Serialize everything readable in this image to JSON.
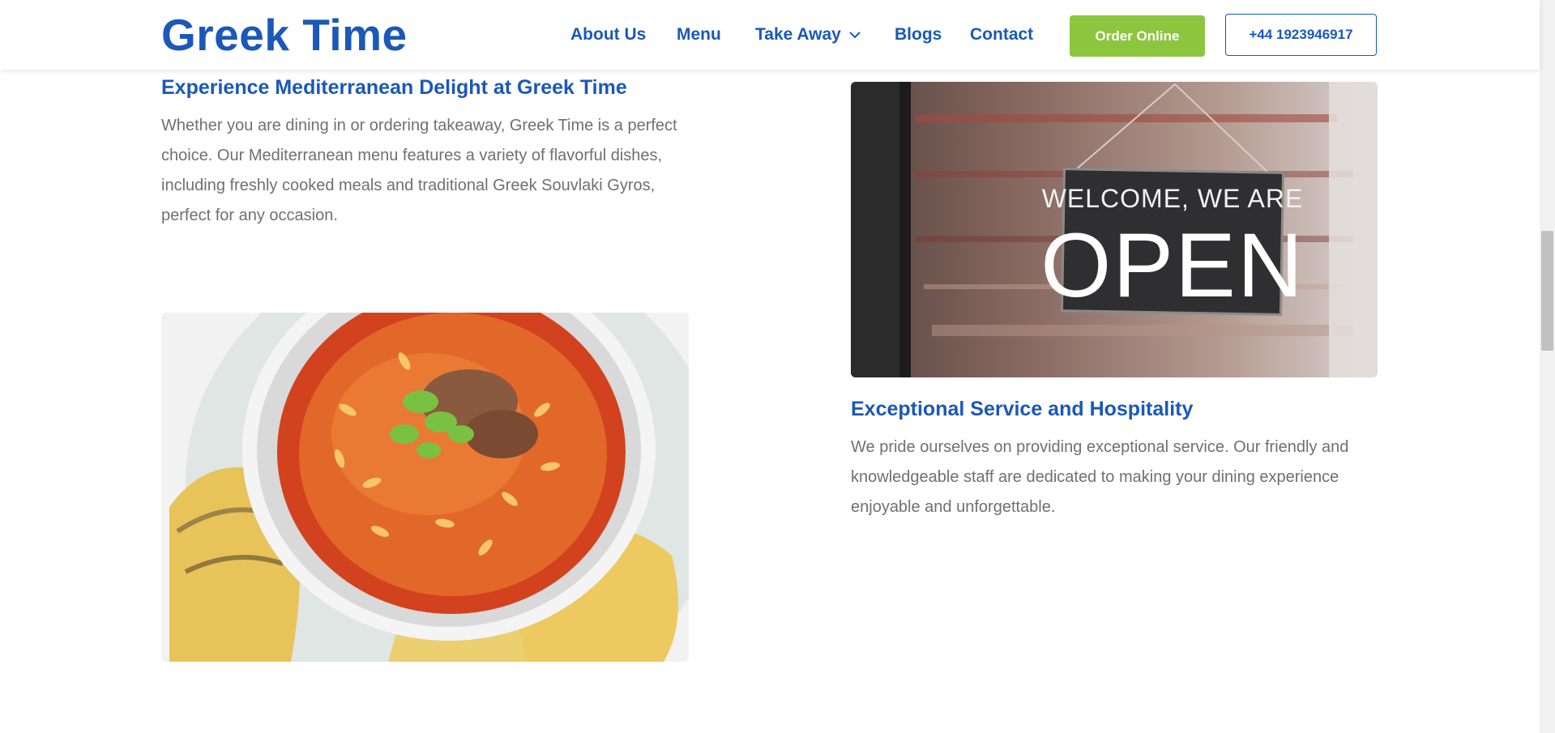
{
  "header": {
    "logo": "Greek Time",
    "nav": [
      {
        "label": "About Us"
      },
      {
        "label": "Menu"
      },
      {
        "label": "Take Away"
      },
      {
        "label": "Blogs"
      },
      {
        "label": "Contact"
      }
    ],
    "order_button": "Order Online",
    "phone_button": "+44 1923946917"
  },
  "section1": {
    "heading": "Experience Mediterranean Delight at Greek Time",
    "text": "Whether you are dining in or ordering takeaway, Greek Time is a perfect choice. Our Mediterranean menu features a variety of flavorful dishes, including freshly cooked meals and traditional Greek Souvlaki Gyros, perfect for any occasion."
  },
  "section2": {
    "heading": "Exceptional Service and Hospitality",
    "text": "We pride ourselves on providing exceptional service. Our friendly and knowledgeable staff are dedicated to making your dining experience enjoyable and unforgettable."
  },
  "open_sign": {
    "line1": "WELCOME, WE ARE",
    "line2": "OPEN"
  },
  "colors": {
    "brand_blue": "#1b58b8",
    "accent_green": "#8cc63f",
    "body_text": "#707070"
  }
}
